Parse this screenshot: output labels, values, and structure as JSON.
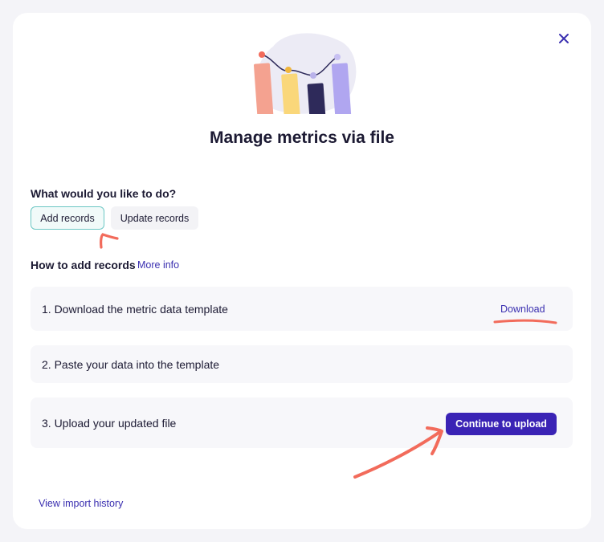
{
  "dialog": {
    "title": "Manage metrics via file",
    "close_icon": "close-icon"
  },
  "action_choice": {
    "question": "What would you like to do?",
    "options": [
      "Add records",
      "Update records"
    ],
    "selected": "Add records"
  },
  "howto": {
    "heading": "How to add records",
    "more_info_label": "More info"
  },
  "steps": [
    {
      "text": "1. Download the metric data template",
      "action": "Download"
    },
    {
      "text": "2. Paste your data into the template"
    },
    {
      "text": "3. Upload your updated file",
      "action": "Continue to upload"
    }
  ],
  "footer": {
    "history_link": "View import history"
  },
  "colors": {
    "accent": "#3a23b5",
    "link": "#3a2fb0",
    "selected_border": "#6cc7c4",
    "annotation": "#f26b5b"
  }
}
